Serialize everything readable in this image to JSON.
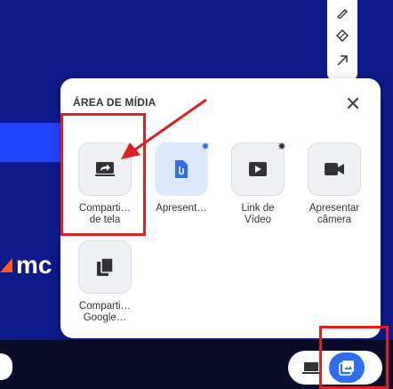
{
  "dialog": {
    "title": "ÁREA DE MÍDIA",
    "close_label": "✕"
  },
  "tiles": [
    {
      "line1": "Comparti…",
      "line2": "de tela"
    },
    {
      "line1": "Apresent…",
      "line2": ""
    },
    {
      "line1": "Link de",
      "line2": "Vídeo"
    },
    {
      "line1": "Apresentar",
      "line2": "câmera"
    },
    {
      "line1": "Comparti…",
      "line2": "Google…"
    }
  ],
  "background": {
    "brand_text": "mc"
  },
  "colors": {
    "background": "#0e1a8c",
    "accent": "#2f6cf2",
    "annotation": "#e02020"
  },
  "icons": {
    "tools": [
      "pencil-icon",
      "eraser-icon",
      "arrow-icon"
    ],
    "tiles": [
      "share-screen-icon",
      "presentation-file-icon",
      "video-link-icon",
      "camera-icon",
      "google-slides-icon"
    ],
    "toggle": [
      "screen-icon",
      "media-icon"
    ]
  }
}
